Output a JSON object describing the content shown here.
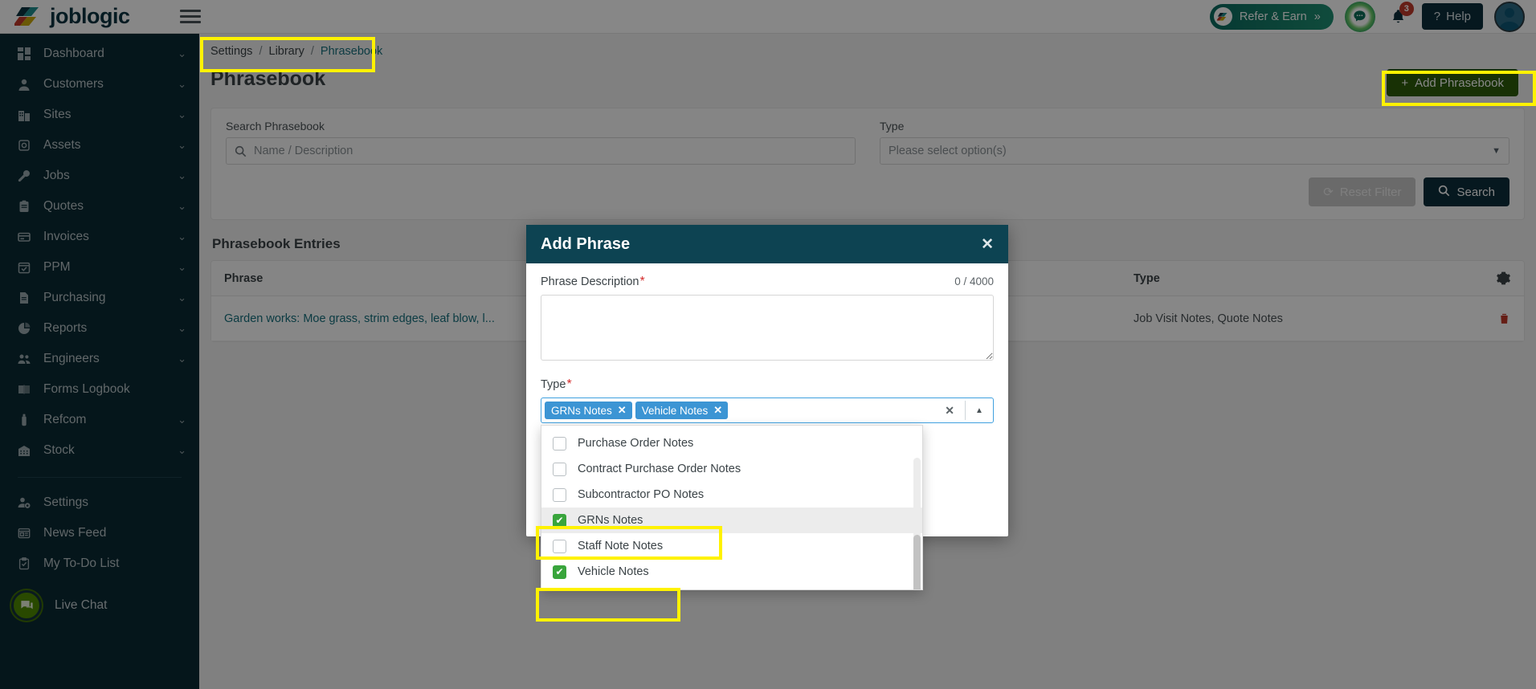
{
  "header": {
    "logo_text": "joblogic",
    "logo_icon": "joblogic-logo-icon",
    "menu_icon": "hamburger-menu-icon",
    "refer_label": "Refer & Earn",
    "refer_chevrons": "»",
    "chat_icon": "chat-bubble-icon",
    "bell_icon": "notification-bell-icon",
    "bell_count": "3",
    "help_icon": "question-mark-icon",
    "help_label": "Help",
    "avatar_icon": "user-avatar-icon"
  },
  "sidebar": {
    "items": [
      {
        "label": "Dashboard",
        "icon": "dashboard-grid-icon",
        "chevron": "⌄"
      },
      {
        "label": "Customers",
        "icon": "person-icon",
        "chevron": "⌄"
      },
      {
        "label": "Sites",
        "icon": "building-icon",
        "chevron": "⌄"
      },
      {
        "label": "Assets",
        "icon": "asset-box-icon",
        "chevron": "⌄"
      },
      {
        "label": "Jobs",
        "icon": "wrench-icon",
        "chevron": "⌄"
      },
      {
        "label": "Quotes",
        "icon": "clipboard-icon",
        "chevron": "⌄"
      },
      {
        "label": "Invoices",
        "icon": "invoice-card-icon",
        "chevron": "⌄"
      },
      {
        "label": "PPM",
        "icon": "calendar-check-icon",
        "chevron": "⌄"
      },
      {
        "label": "Purchasing",
        "icon": "document-icon",
        "chevron": "⌄"
      },
      {
        "label": "Reports",
        "icon": "pie-chart-icon",
        "chevron": "⌄"
      },
      {
        "label": "Engineers",
        "icon": "people-icon",
        "chevron": "⌄"
      },
      {
        "label": "Forms Logbook",
        "icon": "open-book-icon",
        "chevron": ""
      },
      {
        "label": "Refcom",
        "icon": "cylinder-icon",
        "chevron": "⌄"
      },
      {
        "label": "Stock",
        "icon": "warehouse-icon",
        "chevron": "⌄"
      }
    ],
    "secondary_items": [
      {
        "label": "Settings",
        "icon": "user-gear-icon",
        "chevron": ""
      },
      {
        "label": "News Feed",
        "icon": "news-icon",
        "chevron": ""
      },
      {
        "label": "My To-Do List",
        "icon": "todo-clipboard-icon",
        "chevron": ""
      }
    ],
    "live_chat": {
      "label": "Live Chat",
      "icon": "live-chat-icon"
    }
  },
  "breadcrumb": {
    "items": [
      "Settings",
      "Library",
      "Phrasebook"
    ],
    "separator": "/"
  },
  "page": {
    "title": "Phrasebook",
    "add_button_label": "Add Phrasebook",
    "add_button_icon": "plus-icon",
    "add_button_color": "#2f5d0a"
  },
  "filters": {
    "search_label": "Search Phrasebook",
    "search_placeholder": "Name / Description",
    "search_value": "",
    "search_icon": "search-icon",
    "type_label": "Type",
    "type_placeholder": "Please select option(s)",
    "type_value": "",
    "type_caret_icon": "chevron-down-icon",
    "reset_label": "Reset Filter",
    "reset_icon": "refresh-icon",
    "search_button_label": "Search",
    "search_button_icon": "search-icon"
  },
  "table": {
    "section_title": "Phrasebook Entries",
    "gear_icon": "gear-icon",
    "columns": [
      "Phrase",
      "Type"
    ],
    "rows": [
      {
        "phrase": "Garden works: Moe grass, strim edges, leaf blow, l...",
        "type": "Job Visit Notes, Quote Notes",
        "delete_icon": "trash-icon"
      }
    ]
  },
  "modal": {
    "title": "Add Phrase",
    "close_icon": "close-icon",
    "description_label": "Phrase Description",
    "description_required": "*",
    "description_counter": "0 / 4000",
    "description_value": "",
    "type_label": "Type",
    "type_required": "*",
    "chips": [
      {
        "label": "GRNs Notes",
        "remove_icon": "chip-remove-icon"
      },
      {
        "label": "Vehicle Notes",
        "remove_icon": "chip-remove-icon"
      }
    ],
    "clear_icon": "clear-all-icon",
    "toggle_icon": "chevron-up-icon",
    "input_value": "",
    "options": [
      {
        "label": "Purchase Order Notes",
        "checked": false,
        "highlighted": false
      },
      {
        "label": "Contract Purchase Order Notes",
        "checked": false,
        "highlighted": false
      },
      {
        "label": "Subcontractor PO Notes",
        "checked": false,
        "highlighted": false
      },
      {
        "label": "GRNs Notes",
        "checked": true,
        "highlighted": true
      },
      {
        "label": "Staff Note Notes",
        "checked": false,
        "highlighted": false
      },
      {
        "label": "Vehicle Notes",
        "checked": true,
        "highlighted": false
      }
    ]
  },
  "annotations": {
    "highlight_color": "#fff200",
    "boxes": [
      "breadcrumb",
      "add-phrasebook-button",
      "grns-notes-option",
      "vehicle-notes-option"
    ]
  }
}
